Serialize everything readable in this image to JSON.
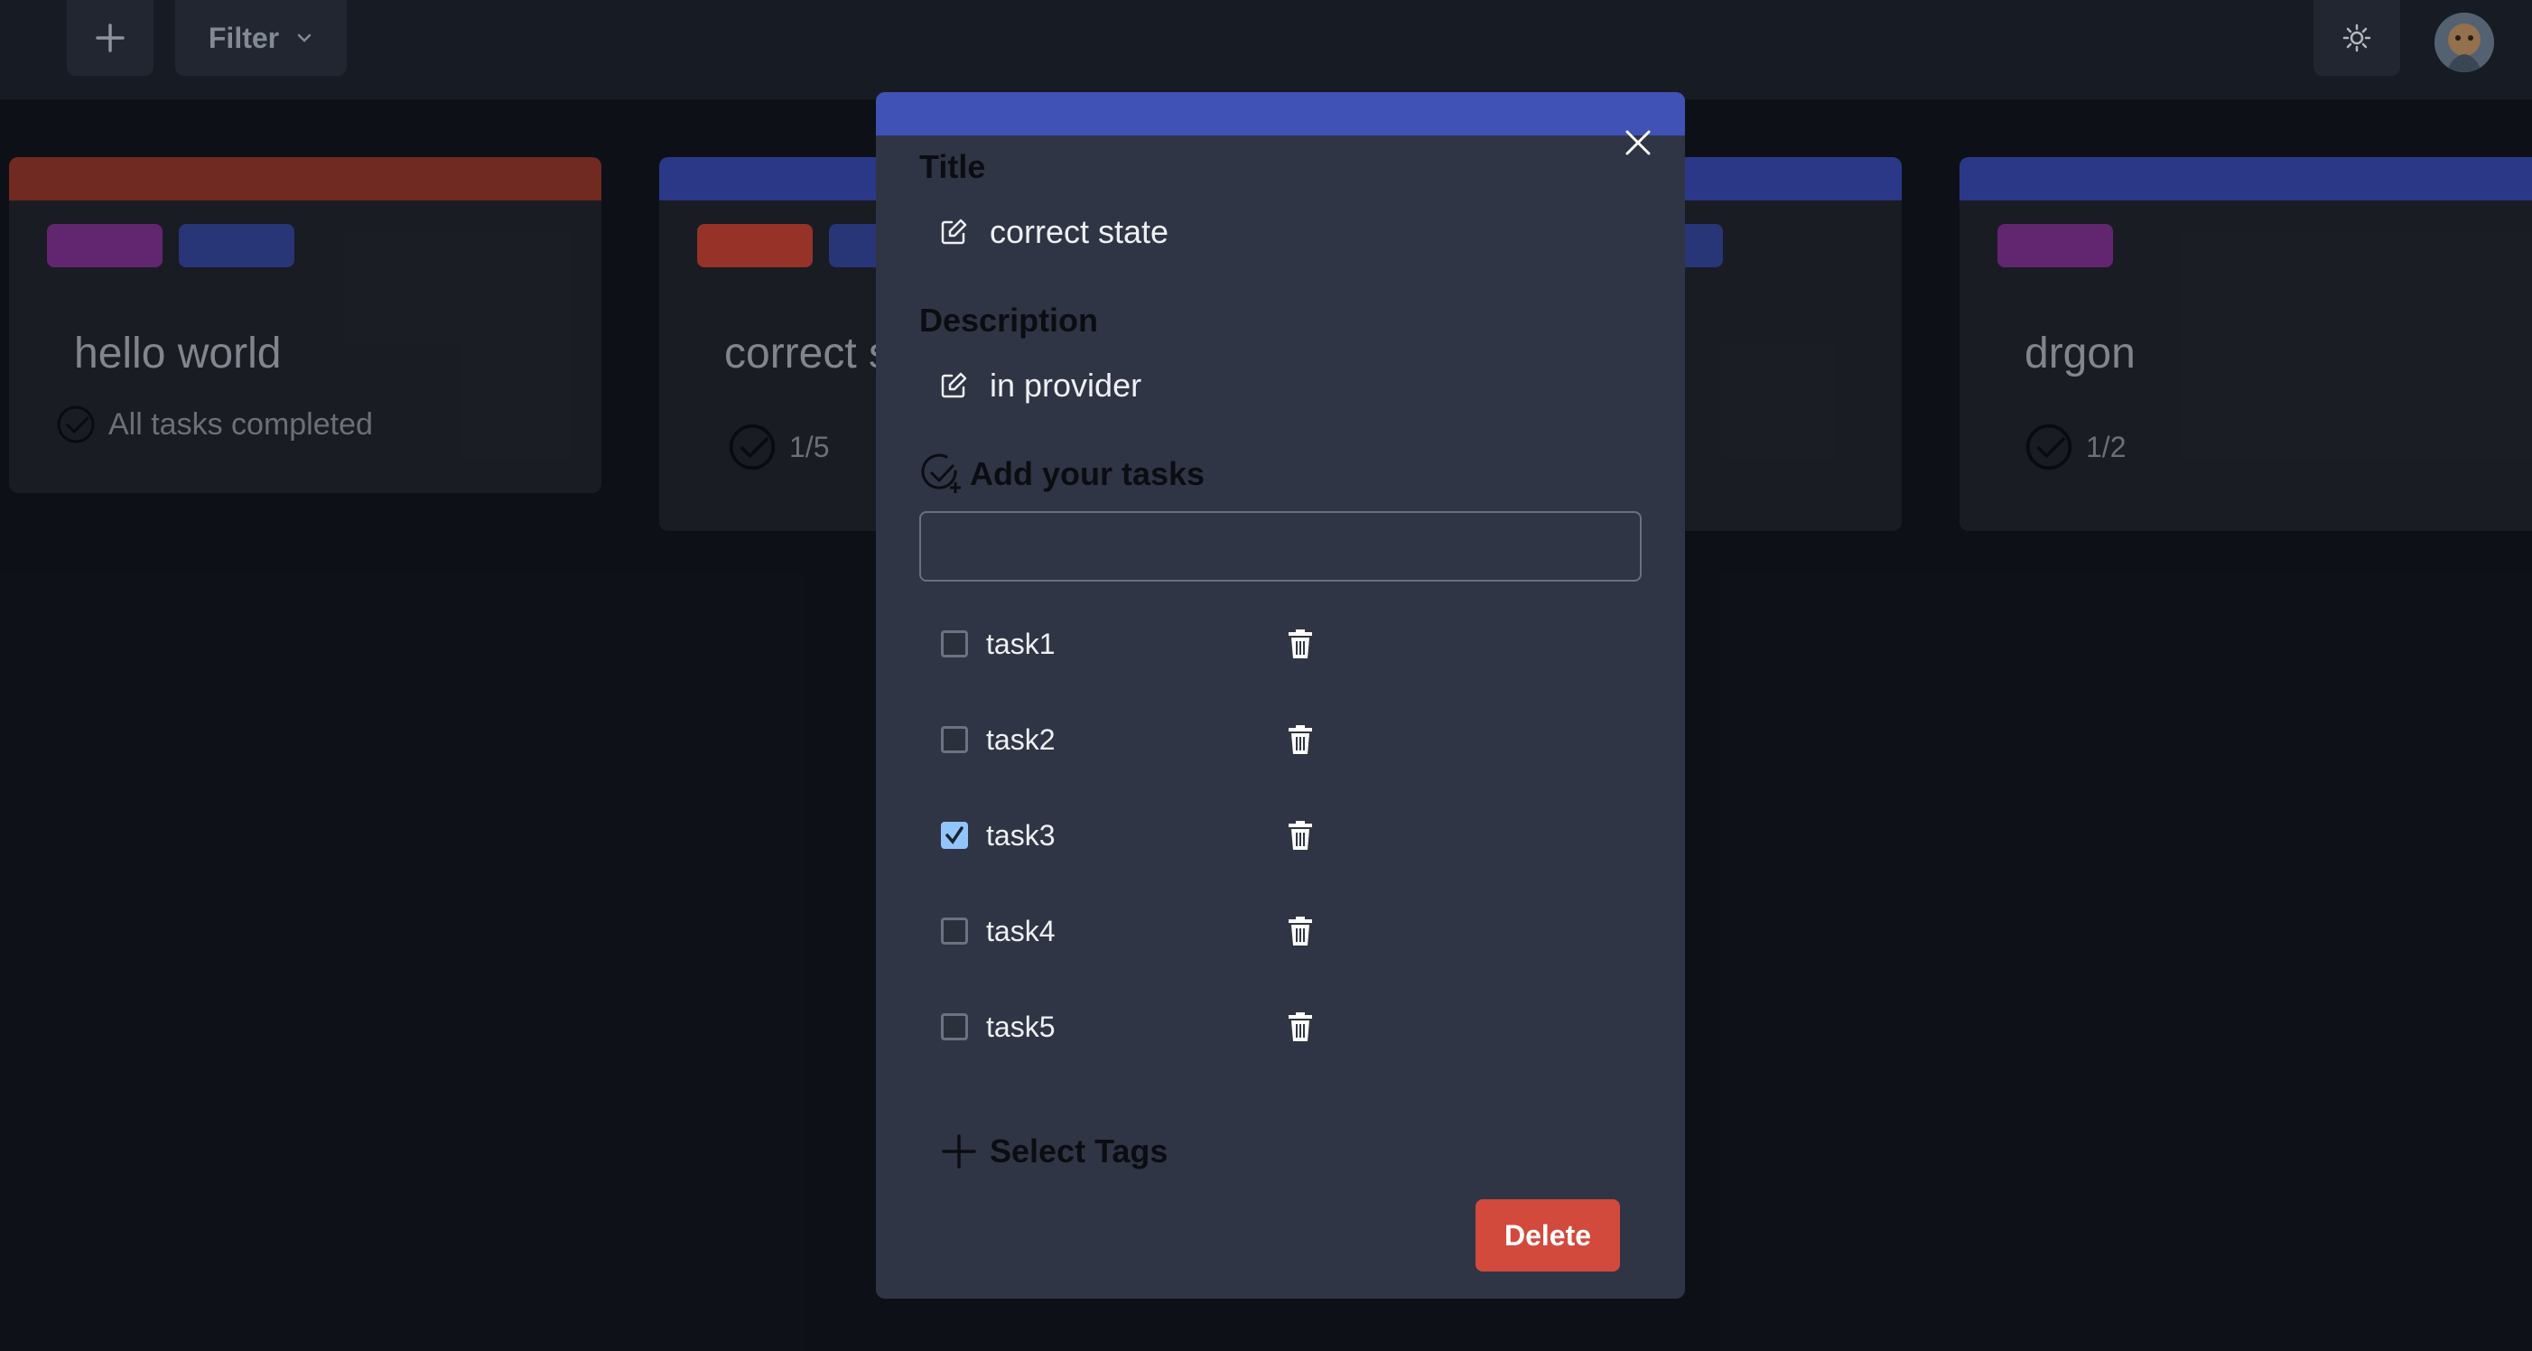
{
  "topbar": {
    "add_icon": "plus-icon",
    "filter_label": "Filter",
    "filter_icon": "chevron-down-icon",
    "theme_icon": "sun-icon"
  },
  "cards": [
    {
      "title": "hello world",
      "status": "All tasks completed",
      "strip_color": "#7a2e24",
      "tags": [
        "#6b2a7a",
        "#2c3a82"
      ]
    },
    {
      "title": "correct s",
      "status": "1/5",
      "strip_color": "#2f3d93",
      "tags": [
        "#a3372b",
        "#2c3a82"
      ]
    },
    {
      "title": "",
      "status": "",
      "strip_color": "#2f3d93",
      "tags": [
        "#2c3a82"
      ]
    },
    {
      "title": "drgon",
      "status": "1/2",
      "strip_color": "#2f3d93",
      "tags": [
        "#6b2a7a"
      ]
    }
  ],
  "modal": {
    "title_label": "Title",
    "title_value": "correct state",
    "description_label": "Description",
    "description_value": "in provider",
    "tasks_heading": "Add your tasks",
    "task_input_value": "",
    "tasks": [
      {
        "label": "task1",
        "done": false
      },
      {
        "label": "task2",
        "done": false
      },
      {
        "label": "task3",
        "done": true
      },
      {
        "label": "task4",
        "done": false
      },
      {
        "label": "task5",
        "done": false
      }
    ],
    "select_tags_label": "Select Tags",
    "delete_label": "Delete",
    "accent_color": "#4052b5",
    "delete_color": "#d14a3c"
  }
}
